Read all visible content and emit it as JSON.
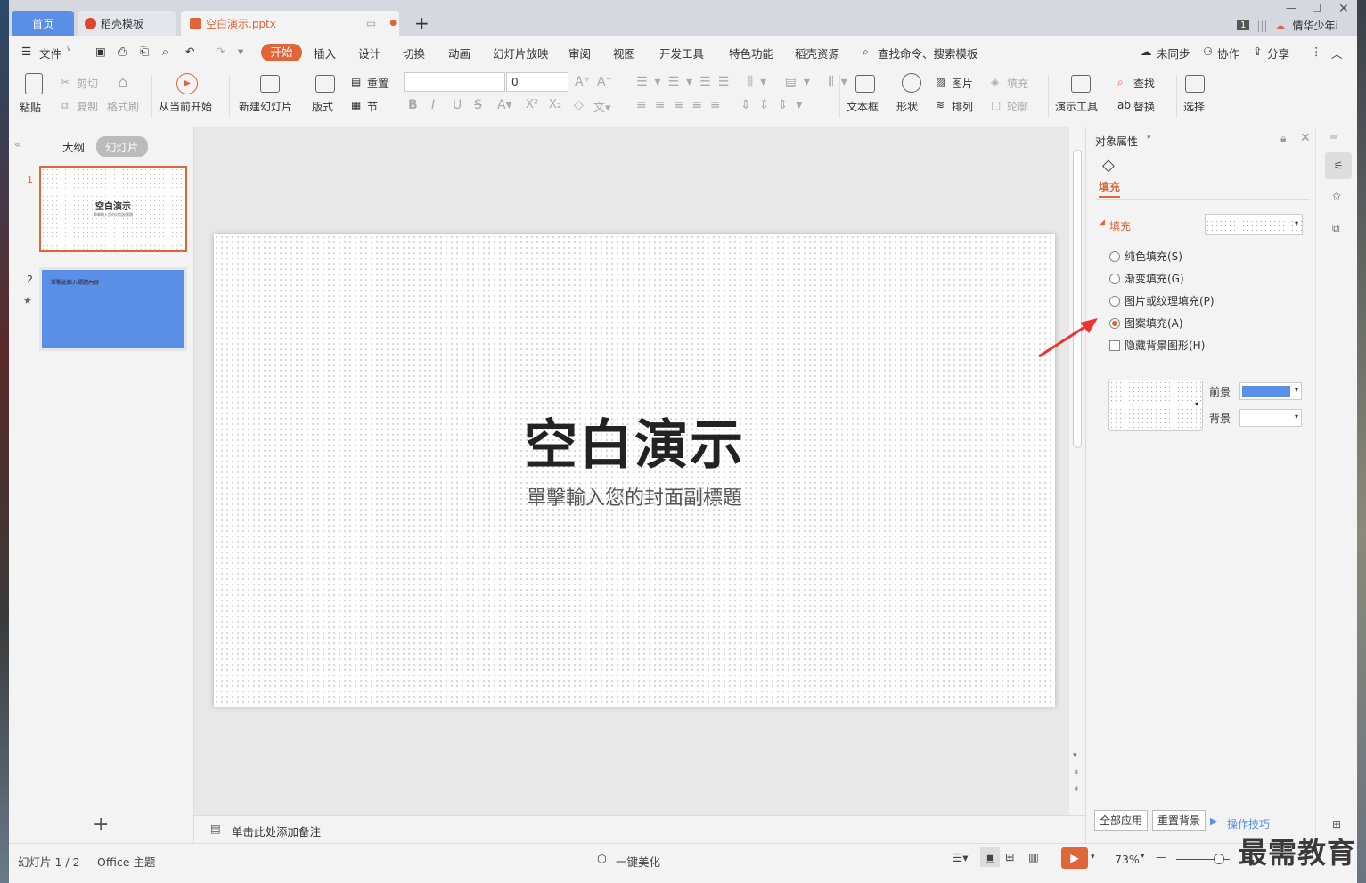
{
  "tabs": {
    "home": "首页",
    "template": "稻壳模板",
    "doc": "空白演示.pptx"
  },
  "window": {
    "user": "情华少年i",
    "page_badge": "1"
  },
  "menu": {
    "file": "文件",
    "items": [
      "开始",
      "插入",
      "设计",
      "切换",
      "动画",
      "幻灯片放映",
      "审阅",
      "视图",
      "开发工具",
      "特色功能",
      "稻壳资源"
    ],
    "search": "查找命令、搜索模板",
    "sync": "未同步",
    "collab": "协作",
    "share": "分享"
  },
  "ribbon": {
    "paste": "粘贴",
    "cut": "剪切",
    "copy": "复制",
    "format_painter": "格式刷",
    "from_current": "从当前开始",
    "new_slide": "新建幻灯片",
    "layout": "版式",
    "reset": "重置",
    "section": "节",
    "font_size": "0",
    "textbox": "文本框",
    "shape": "形状",
    "picture": "图片",
    "fill": "填充",
    "arrange": "排列",
    "outline": "轮廓",
    "present_tools": "演示工具",
    "find": "查找",
    "replace": "替换",
    "select": "选择"
  },
  "slidepane": {
    "outline_tab": "大纲",
    "slides_tab": "幻灯片",
    "slide1_num": "1",
    "slide2_num": "2",
    "thumb1_title": "空白演示",
    "thumb1_sub": "單擊輸入您的封面副標題",
    "thumb2_text": "單擊此輸入標題內容",
    "add": "+"
  },
  "slide": {
    "title": "空白演示",
    "subtitle": "單擊輸入您的封面副標題"
  },
  "notes": {
    "placeholder": "单击此处添加备注"
  },
  "props": {
    "header": "对象属性",
    "tab_fill": "填充",
    "section_fill": "填充",
    "opt_solid": "纯色填充(S)",
    "opt_gradient": "渐变填充(G)",
    "opt_picture": "图片或纹理填充(P)",
    "opt_pattern": "图案填充(A)",
    "opt_hide_bg": "隐藏背景图形(H)",
    "fg_label": "前景",
    "bg_label": "背景",
    "fg_color": "#5b8ee6",
    "apply_all": "全部应用",
    "reset_bg": "重置背景",
    "tips": "操作技巧"
  },
  "status": {
    "slide_count": "幻灯片 1 / 2",
    "theme": "Office 主题",
    "beautify": "一键美化",
    "zoom": "73%"
  },
  "watermark": "最需教育",
  "colors": {
    "accent": "#e0663a",
    "blue": "#5b8ee6"
  }
}
